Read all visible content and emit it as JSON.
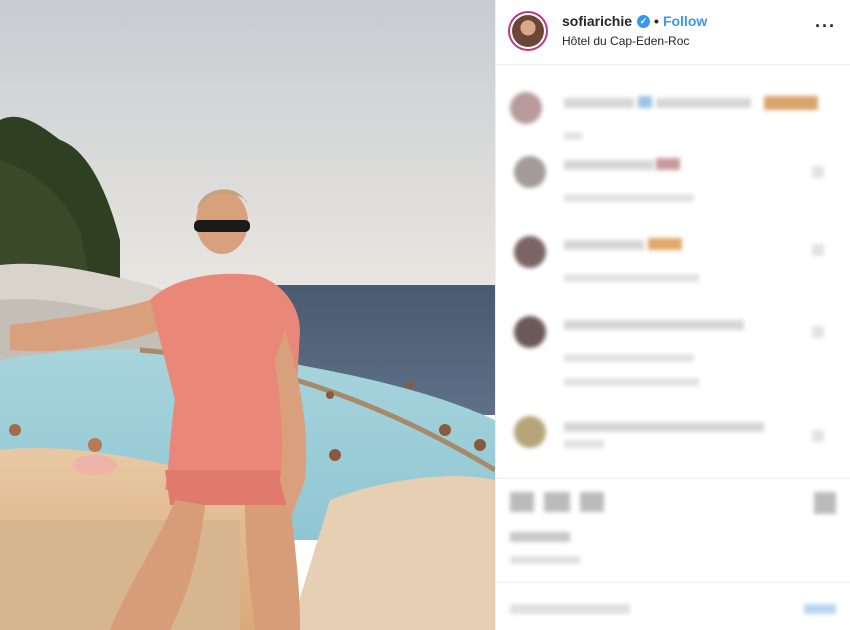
{
  "header": {
    "username": "sofiarichie",
    "verified_icon": "verified-badge-icon",
    "separator": "•",
    "follow_label": "Follow",
    "location": "Hôtel du Cap-Eden-Roc",
    "more_icon": "more-options-icon",
    "more_label": "···"
  },
  "colors": {
    "link_blue": "#3897f0",
    "text": "#262626",
    "divider": "#efefef"
  },
  "comments": [
    {
      "name": "commenter-1"
    },
    {
      "name": "commenter-2"
    },
    {
      "name": "commenter-3"
    },
    {
      "name": "commenter-4"
    },
    {
      "name": "commenter-5"
    }
  ],
  "actions": {
    "icons": [
      "heart-icon",
      "comment-icon",
      "share-icon",
      "bookmark-icon"
    ]
  }
}
